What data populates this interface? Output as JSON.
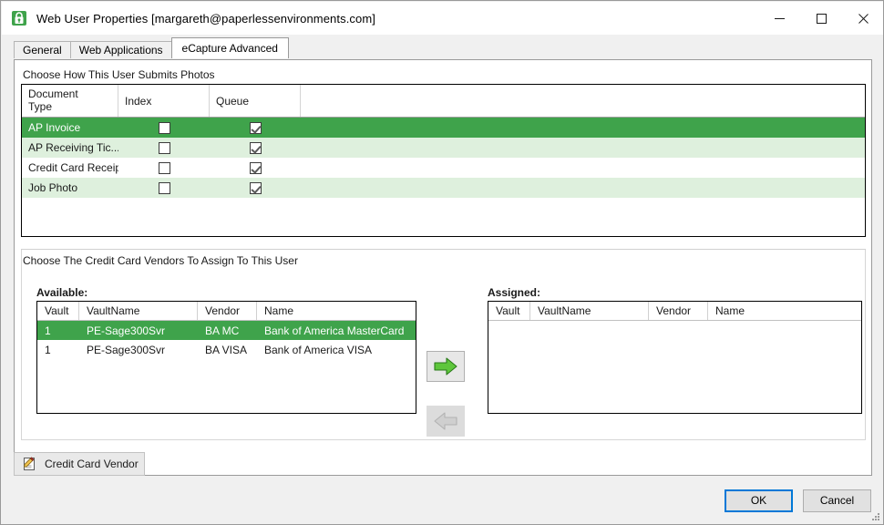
{
  "window": {
    "title": "Web User Properties [margareth@paperlessenvironments.com]",
    "app_icon": "lock-shield-icon",
    "controls": {
      "minimize": "minimize-icon",
      "maximize": "maximize-icon",
      "close": "close-icon"
    }
  },
  "tabs": [
    {
      "label": "General",
      "selected": false
    },
    {
      "label": "Web Applications",
      "selected": false
    },
    {
      "label": "eCapture Advanced",
      "selected": true
    }
  ],
  "photos_section": {
    "label": "Choose How This User Submits Photos",
    "columns": [
      "Document\nType",
      "Index",
      "Queue",
      ""
    ],
    "column_headers": {
      "doc_type_line1": "Document",
      "doc_type_line2": "Type",
      "index": "Index",
      "queue": "Queue",
      "spacer": ""
    },
    "rows": [
      {
        "doc_type": "AP Invoice",
        "index": false,
        "queue": true,
        "selected": true
      },
      {
        "doc_type": "AP Receiving Tic...",
        "index": false,
        "queue": true,
        "selected": false
      },
      {
        "doc_type": "Credit Card Receipt",
        "index": false,
        "queue": true,
        "selected": false
      },
      {
        "doc_type": "Job Photo",
        "index": false,
        "queue": true,
        "selected": false
      }
    ]
  },
  "vendors_section": {
    "label": "Choose The Credit Card Vendors To Assign To This User",
    "available": {
      "label": "Available:",
      "columns": [
        "Vault",
        "VaultName",
        "Vendor",
        "Name"
      ],
      "rows": [
        {
          "vault": "1",
          "vault_name": "PE-Sage300Svr",
          "vendor": "BA MC",
          "name": "Bank of America MasterCard",
          "selected": true
        },
        {
          "vault": "1",
          "vault_name": "PE-Sage300Svr",
          "vendor": "BA VISA",
          "name": "Bank of America VISA",
          "selected": false
        }
      ]
    },
    "assigned": {
      "label": "Assigned:",
      "columns": [
        "Vault",
        "VaultName",
        "Vendor",
        "Name"
      ],
      "rows": []
    },
    "buttons": {
      "assign": "arrow-right-icon",
      "unassign": "arrow-left-icon"
    }
  },
  "toolbar": {
    "credit_card_vendor_label": "Credit Card Vendor",
    "credit_card_vendor_icon": "note-pencil-icon"
  },
  "footer": {
    "ok_label": "OK",
    "cancel_label": "Cancel"
  },
  "colors": {
    "selection_green": "#3fa34b",
    "alt_row_green": "#def0dd",
    "accent_blue": "#0078d7",
    "arrow_green": "#5ec63c"
  }
}
